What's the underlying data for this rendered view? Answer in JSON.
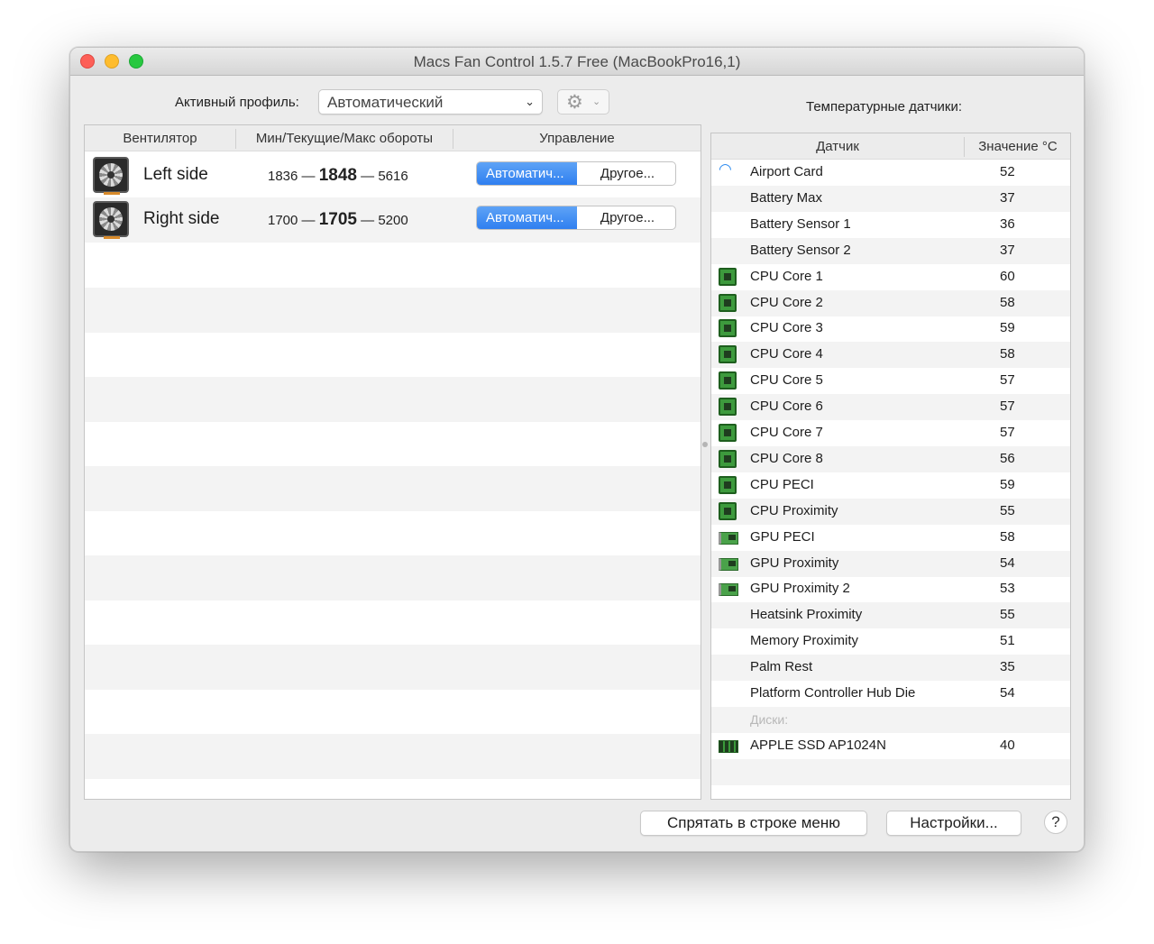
{
  "window": {
    "title": "Macs Fan Control 1.5.7 Free (MacBookPro16,1)"
  },
  "profile": {
    "label": "Активный профиль:",
    "value": "Автоматический"
  },
  "fans": {
    "columns": [
      "Вентилятор",
      "Мин/Текущие/Макс обороты",
      "Управление"
    ],
    "rows": [
      {
        "name": "Left side",
        "min": "1836",
        "current": "1848",
        "max": "5616",
        "mode_auto": "Автоматич...",
        "mode_other": "Другое..."
      },
      {
        "name": "Right side",
        "min": "1700",
        "current": "1705",
        "max": "5200",
        "mode_auto": "Автоматич...",
        "mode_other": "Другое..."
      }
    ],
    "dash": "—"
  },
  "sensors": {
    "title": "Температурные датчики:",
    "columns": [
      "Датчик",
      "Значение °C"
    ],
    "rows": [
      {
        "icon": "wifi",
        "name": "Airport Card",
        "value": "52"
      },
      {
        "icon": "",
        "name": "Battery Max",
        "value": "37"
      },
      {
        "icon": "",
        "name": "Battery Sensor 1",
        "value": "36"
      },
      {
        "icon": "",
        "name": "Battery Sensor 2",
        "value": "37"
      },
      {
        "icon": "chip",
        "name": "CPU Core 1",
        "value": "60"
      },
      {
        "icon": "chip",
        "name": "CPU Core 2",
        "value": "58"
      },
      {
        "icon": "chip",
        "name": "CPU Core 3",
        "value": "59"
      },
      {
        "icon": "chip",
        "name": "CPU Core 4",
        "value": "58"
      },
      {
        "icon": "chip",
        "name": "CPU Core 5",
        "value": "57"
      },
      {
        "icon": "chip",
        "name": "CPU Core 6",
        "value": "57"
      },
      {
        "icon": "chip",
        "name": "CPU Core 7",
        "value": "57"
      },
      {
        "icon": "chip",
        "name": "CPU Core 8",
        "value": "56"
      },
      {
        "icon": "chip",
        "name": "CPU PECI",
        "value": "59"
      },
      {
        "icon": "chip",
        "name": "CPU Proximity",
        "value": "55"
      },
      {
        "icon": "gpu",
        "name": "GPU PECI",
        "value": "58"
      },
      {
        "icon": "gpu",
        "name": "GPU Proximity",
        "value": "54"
      },
      {
        "icon": "gpu",
        "name": "GPU Proximity 2",
        "value": "53"
      },
      {
        "icon": "",
        "name": "Heatsink Proximity",
        "value": "55"
      },
      {
        "icon": "",
        "name": "Memory Proximity",
        "value": "51"
      },
      {
        "icon": "",
        "name": "Palm Rest",
        "value": "35"
      },
      {
        "icon": "",
        "name": "Platform Controller Hub Die",
        "value": "54"
      },
      {
        "section": "Диски:"
      },
      {
        "icon": "ssd",
        "name": "APPLE SSD AP1024N",
        "value": "40"
      }
    ]
  },
  "buttons": {
    "hide": "Спрятать в строке меню",
    "settings": "Настройки...",
    "help": "?"
  }
}
